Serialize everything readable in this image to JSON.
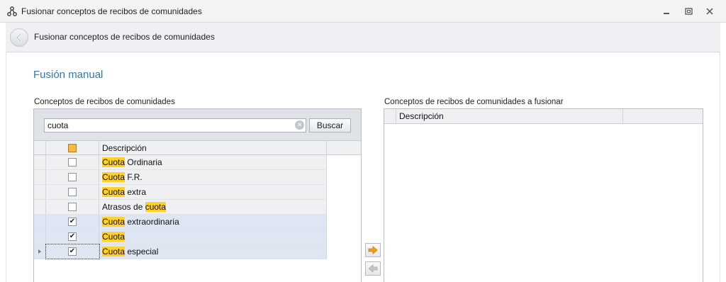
{
  "window": {
    "title": "Fusionar conceptos de recibos de comunidades"
  },
  "header": {
    "title": "Fusionar conceptos de recibos de comunidades"
  },
  "section": {
    "title": "Fusión manual"
  },
  "left": {
    "label": "Conceptos de recibos de comunidades",
    "search_value": "cuota",
    "search_button": "Buscar",
    "column_description": "Descripción",
    "rows": [
      {
        "hl": "Cuota",
        "rest": " Ordinaria",
        "pre": "",
        "checked": false
      },
      {
        "hl": "Cuota",
        "rest": " F.R.",
        "pre": "",
        "checked": false
      },
      {
        "hl": "Cuota",
        "rest": " extra",
        "pre": "",
        "checked": false
      },
      {
        "pre": "Atrasos de ",
        "hl": "cuota",
        "rest": "",
        "checked": false
      },
      {
        "hl": "Cuota",
        "rest": " extraordinaria",
        "pre": "",
        "checked": true
      },
      {
        "hl": "Cuota",
        "rest": "",
        "pre": "",
        "checked": true
      },
      {
        "hl": "Cuota",
        "rest": " especial",
        "pre": "",
        "checked": true
      }
    ]
  },
  "right": {
    "label": "Conceptos de recibos de comunidades a fusionar",
    "column_description": "Descripción"
  },
  "icons": {
    "app": "hierarchy-icon",
    "back": "back-arrow-icon",
    "add": "arrow-right-icon",
    "remove": "arrow-left-icon"
  },
  "colors": {
    "accent": "#2b7ab5",
    "highlight": "#ffd02b",
    "add_arrow": "#f0a020"
  }
}
